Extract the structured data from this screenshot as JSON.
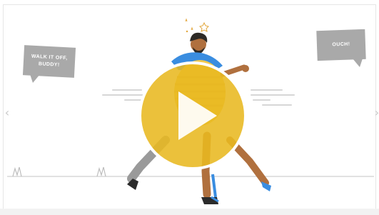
{
  "video": {
    "bubble_left_text": "WALK IT OFF,\nBUDDY!",
    "bubble_right_text": "OUCH!",
    "play_icon": "play-icon",
    "prev_icon": "chevron-left-icon",
    "next_icon": "chevron-right-icon",
    "prev_glyph": "‹",
    "next_glyph": "›"
  },
  "colors": {
    "play_fill": "#e8b820",
    "play_ring": "#ffffff",
    "bubble_gray": "#a9a9a9",
    "ground_line": "#cfcfcf"
  }
}
